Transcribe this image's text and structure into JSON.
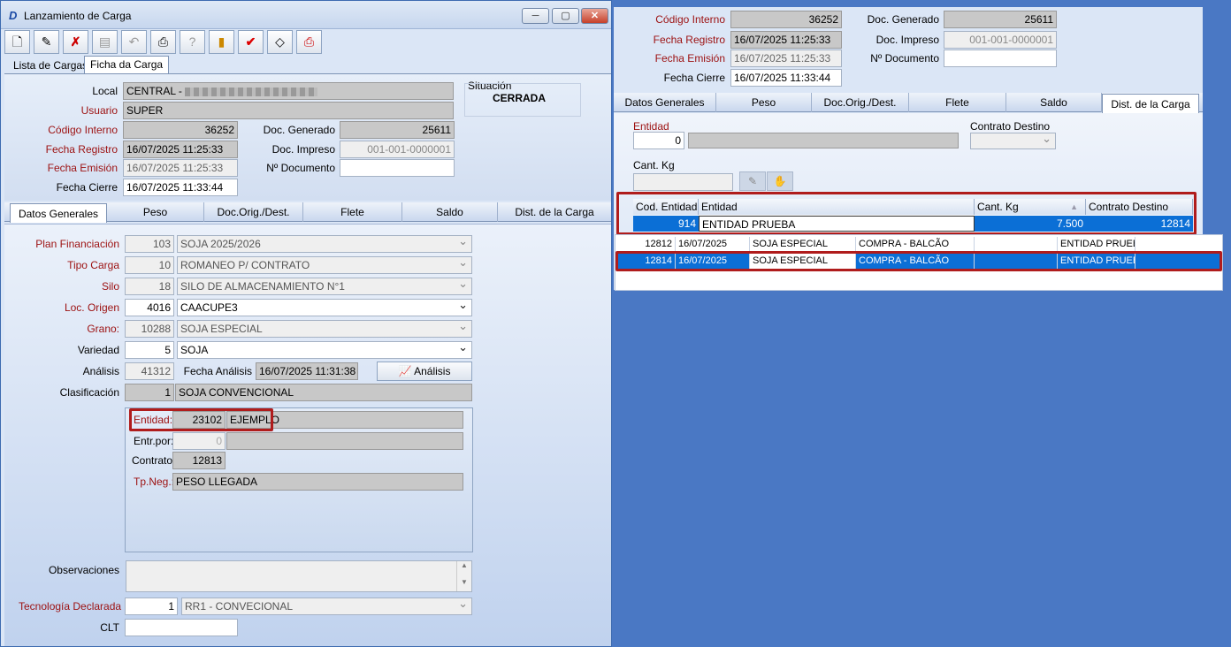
{
  "window": {
    "title": "Lanzamiento de Carga",
    "minimize": "─",
    "maximize": "▢",
    "close": "✕"
  },
  "toolbar": [
    "new-doc-icon",
    "edit-doc-icon",
    "delete-doc-icon",
    "save-icon",
    "undo-icon",
    "print-icon",
    "help-icon",
    "exit-icon",
    "confirm-icon",
    "erase-icon",
    "print-report-icon"
  ],
  "top_tabs": [
    "Lista de Cargas",
    "Ficha da Carga"
  ],
  "header": {
    "local_label": "Local",
    "local_value": "CENTRAL - ",
    "usuario_label": "Usuario",
    "usuario_value": "SUPER",
    "situacion_label": "Situación",
    "situacion_value": "CERRADA",
    "codigo_label": "Código Interno",
    "codigo_value": "36252",
    "docgen_label": "Doc. Generado",
    "docgen_value": "25611",
    "fechareg_label": "Fecha Registro",
    "fechareg_value": "16/07/2025 11:25:33",
    "docimp_label": "Doc. Impreso",
    "docimp_value": "001-001-0000001",
    "fechaemi_label": "Fecha Emisión",
    "fechaemi_value": "16/07/2025 11:25:33",
    "ndoc_label": "Nº Documento",
    "ndoc_value": "",
    "fechacierre_label": "Fecha Cierre",
    "fechacierre_value": "16/07/2025 11:33:44"
  },
  "tabs": [
    "Datos Generales",
    "Peso",
    "Doc.Orig./Dest.",
    "Flete",
    "Saldo",
    "Dist. de la Carga"
  ],
  "datos": {
    "plan_label": "Plan Financiación",
    "plan_code": "103",
    "plan_value": "SOJA 2025/2026",
    "tipo_label": "Tipo Carga",
    "tipo_code": "10",
    "tipo_value": "ROMANEO P/ CONTRATO",
    "silo_label": "Silo",
    "silo_code": "18",
    "silo_value": "SILO DE ALMACENAMIENTO N°1",
    "origen_label": "Loc. Origen",
    "origen_code": "4016",
    "origen_value": "CAACUPE3",
    "grano_label": "Grano:",
    "grano_code": "10288",
    "grano_value": "SOJA ESPECIAL",
    "variedad_label": "Variedad",
    "variedad_code": "5",
    "variedad_value": "SOJA",
    "analisis_label": "Análisis",
    "analisis_code": "41312",
    "fecha_analisis_label": "Fecha Análisis",
    "fecha_analisis_value": "16/07/2025 11:31:38",
    "analisis_button": "Análisis",
    "clasif_label": "Clasificación",
    "clasif_code": "1",
    "clasif_value": "SOJA CONVENCIONAL",
    "entidad_label": "Entidad:",
    "entidad_code": "23102",
    "entidad_value": "EJEMPLO",
    "entrpor_label": "Entr.por:",
    "entrpor_code": "0",
    "contrato_label": "Contrato:",
    "contrato_value": "12813",
    "tpneg_label": "Tp.Neg.:",
    "tpneg_value": "PESO LLEGADA",
    "obs_label": "Observaciones",
    "tec_label": "Tecnología Declarada",
    "tec_code": "1",
    "tec_value": "RR1 - CONVECIONAL",
    "clt_label": "CLT"
  },
  "right": {
    "codigo_label": "Código Interno",
    "codigo_value": "36252",
    "docgen_label": "Doc. Generado",
    "docgen_value": "25611",
    "fechareg_label": "Fecha Registro",
    "fechareg_value": "16/07/2025 11:25:33",
    "docimp_label": "Doc. Impreso",
    "docimp_value": "001-001-0000001",
    "fechaemi_label": "Fecha Emisión",
    "fechaemi_value": "16/07/2025 11:25:33",
    "ndoc_label": "Nº Documento",
    "fechacierre_label": "Fecha Cierre",
    "fechacierre_value": "16/07/2025 11:33:44",
    "entidad_label": "Entidad",
    "entidad_code": "0",
    "contrato_label": "Contrato Destino",
    "cantkg_label": "Cant. Kg",
    "grid_headers": [
      "Cod. Entidad",
      "Entidad",
      "Cant. Kg",
      "Contrato Destino"
    ],
    "grid_row": [
      "914",
      "ENTIDAD PRUEBA",
      "7.500",
      "12814"
    ],
    "list_rows": [
      [
        "12812",
        "16/07/2025",
        "SOJA ESPECIAL",
        "COMPRA - BALCÃO",
        "",
        "ENTIDAD PRUEBA",
        ""
      ],
      [
        "12814",
        "16/07/2025",
        "SOJA ESPECIAL",
        "COMPRA - BALCÃO",
        "",
        "ENTIDAD PRUEBA",
        ""
      ]
    ]
  },
  "colors": {
    "accent": "#0b6fd6",
    "highlight": "#b01c1c",
    "label_red": "#9c1010",
    "desktop": "#4a78c4"
  }
}
